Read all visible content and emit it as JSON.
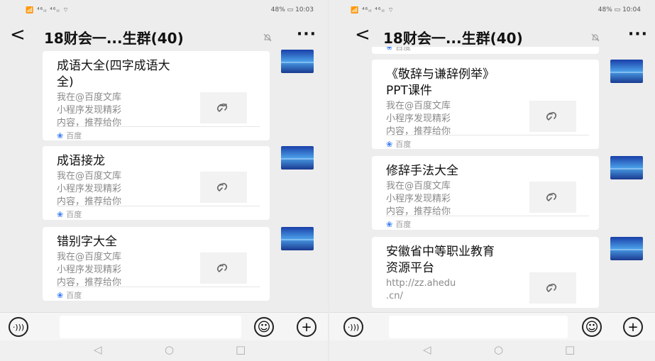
{
  "left": {
    "status": {
      "signal": "📶 ⁴⁶ᵢₗ ⁴⁶ᵢₗ ⌔",
      "battery": "48%",
      "time": "10:03"
    },
    "header": {
      "back": "<",
      "title": "18财会一...生群(40)",
      "more": "···"
    },
    "cards": [
      {
        "title_lines": [
          "成语大全(四字成语大",
          "全)"
        ],
        "desc": [
          "我在@百度文库",
          "小程序发现精彩",
          "内容，推荐给你"
        ],
        "source": "百度"
      },
      {
        "title_lines": [
          "成语接龙"
        ],
        "desc": [
          "我在@百度文库",
          "小程序发现精彩",
          "内容，推荐给你"
        ],
        "source": "百度"
      },
      {
        "title_lines": [
          "错别字大全"
        ],
        "desc": [
          "我在@百度文库",
          "小程序发现精彩",
          "内容，推荐给你"
        ],
        "source": "百度"
      }
    ]
  },
  "right": {
    "status": {
      "signal": "📶 ⁴⁶ᵢₗ ⁴⁶ᵢₗ ⌔",
      "battery": "48%",
      "time": "10:04"
    },
    "header": {
      "back": "<",
      "title": "18财会一...生群(40)",
      "more": "···"
    },
    "partial_source": "百度",
    "cards": [
      {
        "title_lines": [
          "《敬辞与谦辞例举》",
          "PPT课件"
        ],
        "desc": [
          "我在@百度文库",
          "小程序发现精彩",
          "内容，推荐给你"
        ],
        "source": "百度"
      },
      {
        "title_lines": [
          "修辞手法大全"
        ],
        "desc": [
          "我在@百度文库",
          "小程序发现精彩",
          "内容，推荐给你"
        ],
        "source": "百度"
      },
      {
        "title_lines": [
          "安徽省中等职业教育",
          "资源平台"
        ],
        "desc": [
          "http://zz.ahedu",
          ".cn/"
        ],
        "source": ""
      }
    ]
  },
  "input_bar": {
    "voice_icon": "·)))",
    "emoji_icon": "smile-icon",
    "plus_icon": "+"
  },
  "nav_bar": {
    "back": "◁",
    "home": "○",
    "recent": "□"
  },
  "colors": {
    "bg": "#ededed",
    "card": "#ffffff",
    "accent": "#3b7cf2"
  }
}
